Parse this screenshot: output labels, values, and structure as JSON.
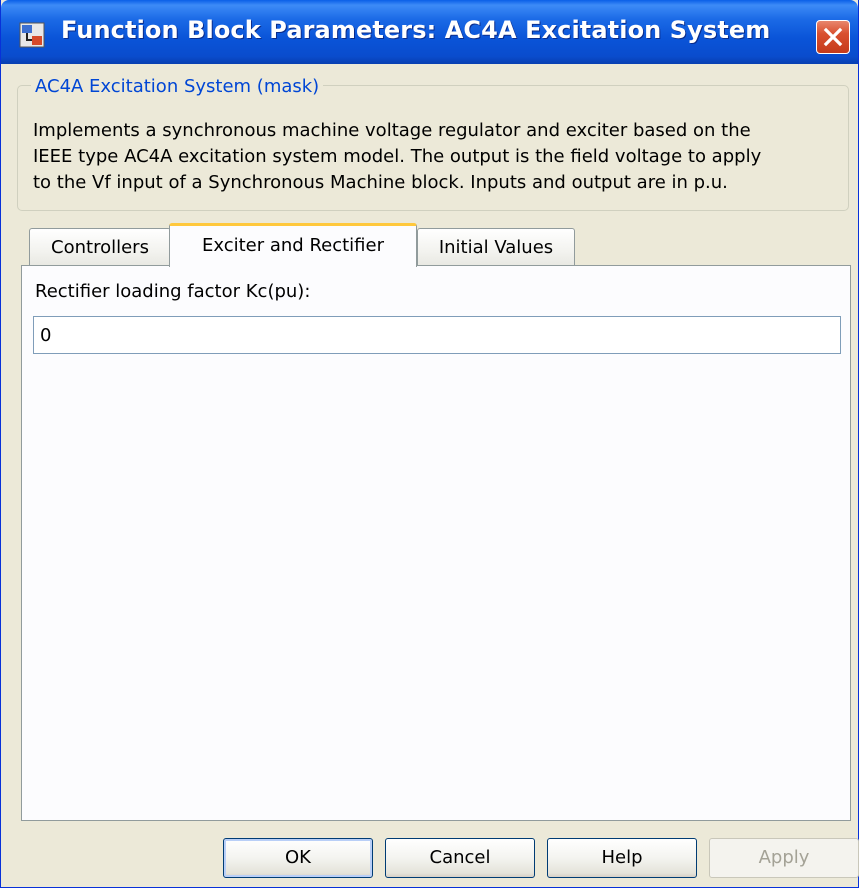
{
  "window": {
    "title": "Function Block Parameters: AC4A Excitation System",
    "titlebar_color": "#0a54d8",
    "close_color": "#d9502f"
  },
  "mask": {
    "group_label": "AC4A Excitation System (mask)",
    "description_lines": [
      "Implements a synchronous machine voltage regulator and exciter based on the",
      "IEEE type AC4A excitation system model. The output is the field voltage to apply",
      "to the Vf input of a Synchronous Machine block. Inputs and output are in p.u."
    ]
  },
  "tabs": [
    {
      "label": "Controllers",
      "active": false
    },
    {
      "label": "Exciter and Rectifier",
      "active": true
    },
    {
      "label": "Initial Values",
      "active": false
    }
  ],
  "parameters": {
    "kc_label": "Rectifier loading factor Kc(pu):",
    "kc_value": "0"
  },
  "buttons": {
    "ok": "OK",
    "cancel": "Cancel",
    "help": "Help",
    "apply": "Apply"
  },
  "icons": {
    "app": "simulink-block-icon",
    "close": "close-icon"
  }
}
